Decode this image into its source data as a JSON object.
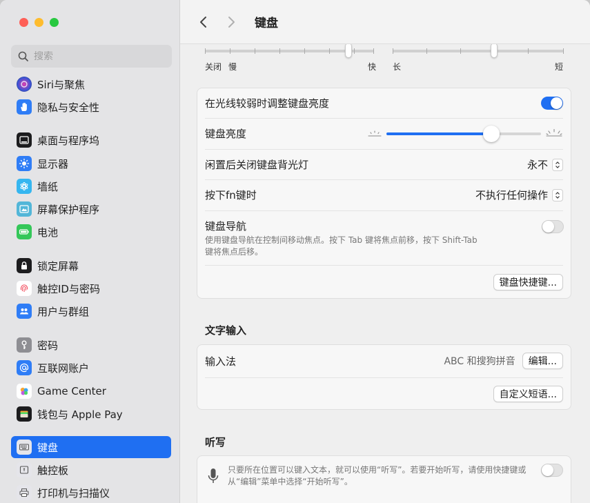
{
  "window": {
    "title": "键盘"
  },
  "sidebar": {
    "search_placeholder": "搜索",
    "items": [
      {
        "label": "Siri与聚焦",
        "icon": "siri-icon"
      },
      {
        "label": "隐私与安全性",
        "icon": "hand-icon"
      },
      {
        "label": "桌面与程序坞",
        "icon": "dock-icon"
      },
      {
        "label": "显示器",
        "icon": "sun-icon"
      },
      {
        "label": "墙纸",
        "icon": "flower-icon"
      },
      {
        "label": "屏幕保护程序",
        "icon": "screensaver-icon"
      },
      {
        "label": "电池",
        "icon": "battery-icon"
      },
      {
        "label": "锁定屏幕",
        "icon": "lock-icon"
      },
      {
        "label": "触控ID与密码",
        "icon": "fingerprint-icon"
      },
      {
        "label": "用户与群组",
        "icon": "users-icon"
      },
      {
        "label": "密码",
        "icon": "key-icon"
      },
      {
        "label": "互联网账户",
        "icon": "at-icon"
      },
      {
        "label": "Game Center",
        "icon": "game-center-icon"
      },
      {
        "label": "钱包与 Apple Pay",
        "icon": "wallet-icon"
      },
      {
        "label": "键盘",
        "icon": "keyboard-icon",
        "selected": true
      },
      {
        "label": "触控板",
        "icon": "trackpad-icon"
      },
      {
        "label": "打印机与扫描仪",
        "icon": "printer-icon"
      }
    ]
  },
  "toolbar": {
    "title": "键盘"
  },
  "repeat": {
    "repeat_rate_labels": {
      "left1": "关闭",
      "left2": "慢",
      "right": "快"
    },
    "delay_labels": {
      "left": "长",
      "right": "短"
    }
  },
  "backlight": {
    "auto_brightness_label": "在光线较弱时调整键盘亮度",
    "auto_brightness_on": true,
    "brightness_label": "键盘亮度",
    "brightness_level": 0.68,
    "idle_label": "闲置后关闭键盘背光灯",
    "idle_value": "永不",
    "fn_label": "按下fn键时",
    "fn_value": "不执行任何操作",
    "nav_label": "键盘导航",
    "nav_desc_line1": "使用键盘导航在控制间移动焦点。按下 Tab 键将焦点前移，按下 Shift-Tab",
    "nav_desc_line2": "键将焦点后移。",
    "nav_on": false,
    "shortcuts_button": "键盘快捷键..."
  },
  "text_input": {
    "section_title": "文字输入",
    "input_method_label": "输入法",
    "input_method_value": "ABC 和搜狗拼音",
    "edit_button": "编辑...",
    "custom_phrases_button": "自定义短语..."
  },
  "dictation": {
    "section_title": "听写",
    "desc_line1": "只要所在位置可以键入文本，就可以使用“听写”。若要开始听写，请使用快捷键或",
    "desc_line2": "从“编辑”菜单中选择“开始听写”。",
    "on": false
  },
  "colors": {
    "accent": "#1f6ff2"
  }
}
